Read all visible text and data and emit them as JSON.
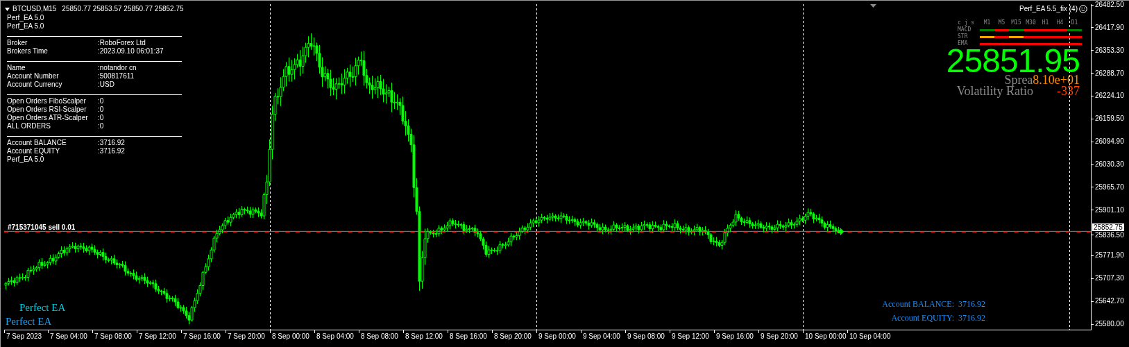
{
  "chart": {
    "symbol": "BTCUSD,M15",
    "quotes": "25850.77 25853.57 25850.77 25852.75"
  },
  "info_panel": {
    "header_lines": [
      "Perf_EA 5.0",
      "Perf_EA 5.0"
    ],
    "sections": [
      {
        "rows": [
          {
            "label": "Broker",
            "value": ":RoboForex Ltd"
          },
          {
            "label": "Brokers Time",
            "value": ":2023.09.10 06:01:37"
          }
        ]
      },
      {
        "rows": [
          {
            "label": "Name",
            "value": ":notandor cn"
          },
          {
            "label": "Account Number",
            "value": ":500817611"
          },
          {
            "label": "Account Currency",
            "value": ":USD"
          }
        ]
      },
      {
        "rows": [
          {
            "label": "Open Orders FiboScalper",
            "value": ":0"
          },
          {
            "label": "Open Orders RSI-Scalper",
            "value": ":0"
          },
          {
            "label": "Open Orders ATR-Scalper",
            "value": ":0"
          },
          {
            "label": "ALL ORDERS",
            "value": ":0"
          }
        ]
      },
      {
        "rows": [
          {
            "label": "Account BALANCE",
            "value": ":3716.92"
          },
          {
            "label": "Account EQUITY",
            "value": ":3716.92"
          }
        ]
      }
    ],
    "footer": "Perf_EA 5.0"
  },
  "ea_title": "Perf_EA 5.5_fix (4)",
  "signal_panel": {
    "corner_label": "c j s",
    "timeframes": [
      "M1",
      "M5",
      "M15",
      "M30",
      "H1",
      "H4",
      "D1"
    ],
    "rows": [
      {
        "label": "MACD",
        "segments": [
          {
            "color": "#008000"
          },
          {
            "color": "#ff0000"
          },
          {
            "color": "#008000"
          },
          {
            "color": "#ff0000"
          },
          {
            "color": "#ff0000"
          },
          {
            "color": "#ff0000"
          },
          {
            "color": "#008000"
          }
        ]
      },
      {
        "label": "STR",
        "segments": [
          {
            "color": "#ffa500"
          },
          {
            "color": "#ff0000"
          },
          {
            "color": "#ffa500"
          },
          {
            "color": "#ff0000"
          },
          {
            "color": "#ff0000"
          },
          {
            "color": "#ff0000"
          },
          {
            "color": "#ff0000"
          }
        ]
      },
      {
        "label": "EMA",
        "segments": [
          {
            "color": "#ff0000"
          },
          {
            "color": "#ff0000"
          },
          {
            "color": "#ff0000"
          },
          {
            "color": "#ff0000"
          },
          {
            "color": "#ff0000"
          },
          {
            "color": "#ff0000"
          },
          {
            "color": "#ff0000"
          }
        ]
      }
    ]
  },
  "big_price": "25851.95",
  "spread": {
    "label": "Sprea",
    "value": "8.10e+01"
  },
  "volatility": {
    "label": "Volatility Ratio",
    "value": "-337"
  },
  "order_label": "#715371045 sell 0.01",
  "brand_labels": [
    {
      "text": "Perfect EA",
      "color": "#00d0e0"
    },
    {
      "text": "Perfect EA",
      "color": "#1ea0f0"
    }
  ],
  "account_summary": [
    {
      "label": "Account BALANCE:",
      "value": "3716.92"
    },
    {
      "label": "Account EQUITY:",
      "value": "3716.92"
    }
  ],
  "price_axis": {
    "labels": [
      "26482.50",
      "26417.90",
      "26353.30",
      "26288.70",
      "26224.10",
      "26159.50",
      "26094.90",
      "26030.30",
      "25965.70",
      "25901.10",
      "25836.50",
      "25771.90",
      "25707.30",
      "25642.70",
      "25580.00"
    ],
    "current_price": "25852.75"
  },
  "time_axis": {
    "labels": [
      "7 Sep 2023",
      "7 Sep 04:00",
      "7 Sep 08:00",
      "7 Sep 12:00",
      "7 Sep 16:00",
      "7 Sep 20:00",
      "8 Sep 00:00",
      "8 Sep 04:00",
      "8 Sep 08:00",
      "8 Sep 12:00",
      "8 Sep 16:00",
      "8 Sep 20:00",
      "9 Sep 00:00",
      "9 Sep 04:00",
      "9 Sep 08:00",
      "9 Sep 12:00",
      "9 Sep 16:00",
      "9 Sep 20:00",
      "10 Sep 00:00",
      "10 Sep 04:00"
    ]
  }
}
